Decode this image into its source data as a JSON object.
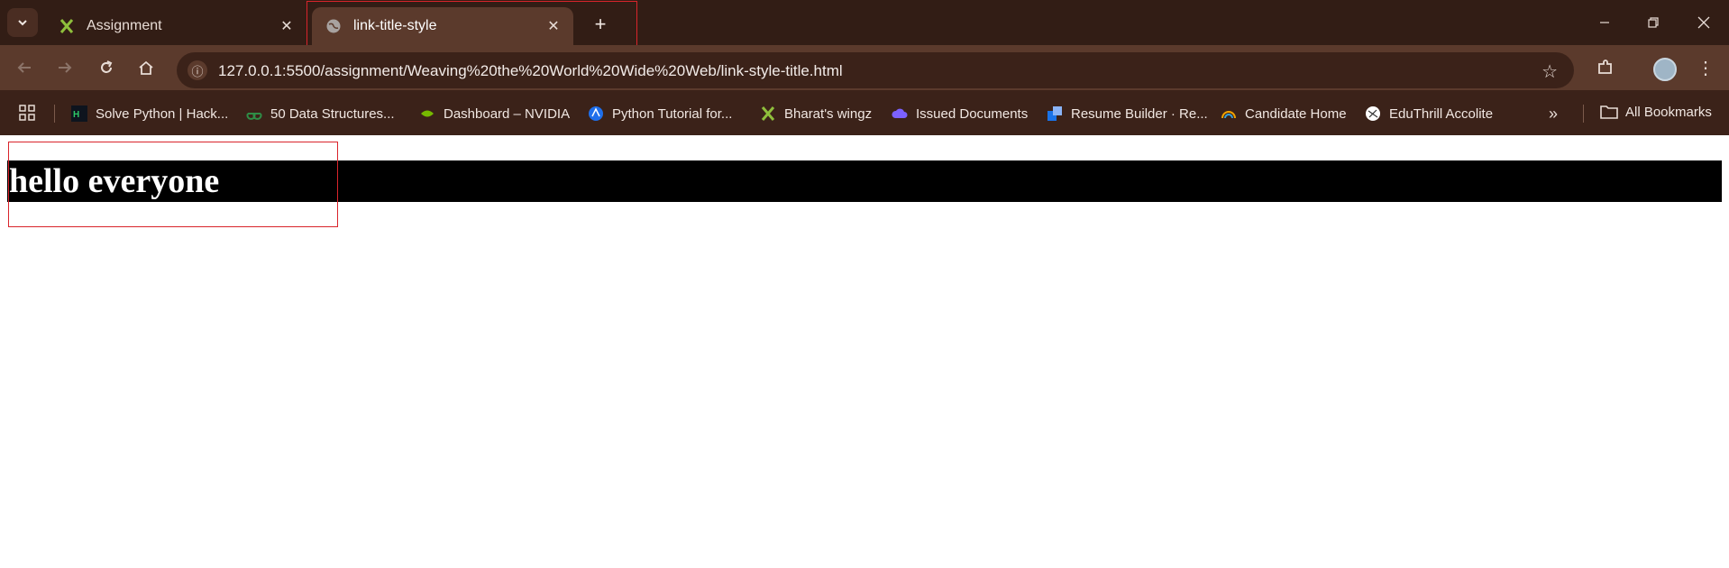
{
  "tabs": [
    {
      "title": "Assignment",
      "favicon": "scissors-icon"
    },
    {
      "title": "link-title-style",
      "favicon": "globe-icon"
    }
  ],
  "address_bar": {
    "url": "127.0.0.1:5500/assignment/Weaving%20the%20World%20Wide%20Web/link-style-title.html"
  },
  "bookmarks": [
    {
      "label": "Solve Python | Hack...",
      "icon": "hackerrank-icon"
    },
    {
      "label": "50 Data Structures...",
      "icon": "gfg-icon"
    },
    {
      "label": "Dashboard – NVIDIA",
      "icon": "nvidia-icon"
    },
    {
      "label": "Python Tutorial for...",
      "icon": "circle-icon"
    },
    {
      "label": "Bharat's wingz",
      "icon": "scissors-icon"
    },
    {
      "label": "Issued Documents",
      "icon": "cloud-icon"
    },
    {
      "label": "Resume Builder · Re...",
      "icon": "squares-icon"
    },
    {
      "label": "Candidate Home",
      "icon": "rainbow-icon"
    },
    {
      "label": "EduThrill Accolite",
      "icon": "globe-icon"
    }
  ],
  "all_bookmarks_label": "All Bookmarks",
  "page": {
    "heading": "hello everyone"
  },
  "colors": {
    "accent_highlight": "#d9242b",
    "chrome": "#3b2219",
    "toolbar": "#5b3a2c",
    "heading_bg": "#000000"
  }
}
